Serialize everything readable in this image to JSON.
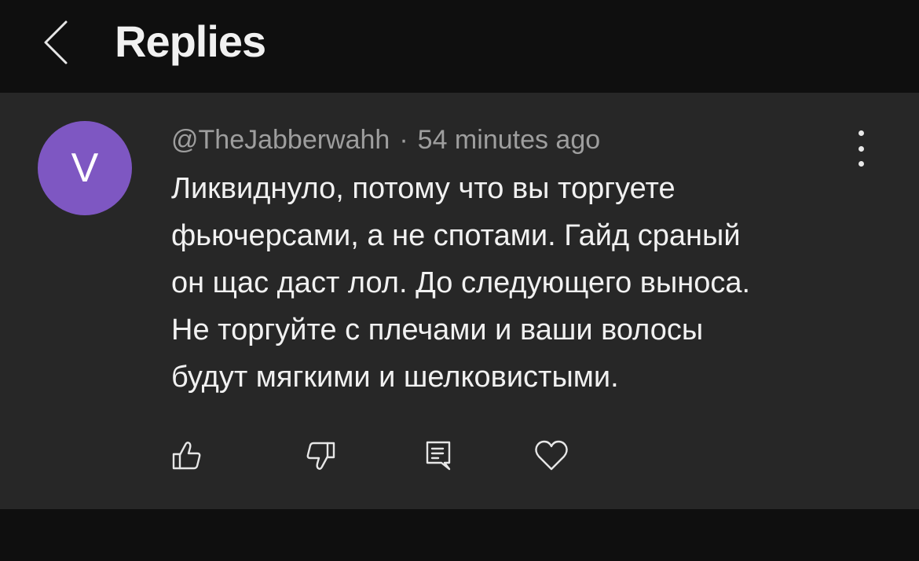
{
  "header": {
    "title": "Replies"
  },
  "comment": {
    "avatar_letter": "V",
    "avatar_color": "#7e57c2",
    "author": "@TheJabberwahh",
    "separator": "·",
    "time": "54 minutes ago",
    "text_lines": [
      "Ликвиднуло, потому что вы торгуете",
      "фьючерсами, а не спотами. Гайд сраный",
      "он щас даст лол. До следующего выноса.",
      "Не торгуйте с плечами и ваши волосы",
      "будут мягкими и шелковистыми."
    ]
  },
  "actions": {
    "icons": [
      "thumbs-up-icon",
      "thumbs-down-icon",
      "reply-icon",
      "heart-icon"
    ]
  },
  "colors": {
    "background": "#0f0f0f",
    "card": "#272727",
    "text": "#f1f1f1",
    "secondary_text": "#9e9e9e"
  }
}
